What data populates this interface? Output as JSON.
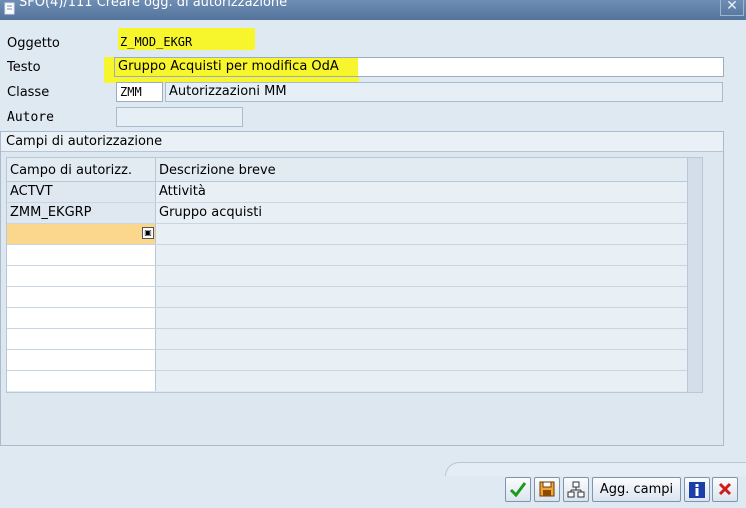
{
  "window": {
    "title": "SFO(4)/111 Creare ogg. di autorizzazione",
    "close_glyph": "✕"
  },
  "form": {
    "oggetto": {
      "label": "Oggetto",
      "value": "Z_MOD_EKGR"
    },
    "testo": {
      "label": "Testo",
      "value": "Gruppo Acquisti per modifica OdA"
    },
    "classe": {
      "label": "Classe",
      "code": "ZMM",
      "description": "Autorizzazioni MM"
    },
    "autore": {
      "label": "Autore",
      "value": ""
    }
  },
  "fields_group": {
    "title": "Campi di autorizzazione",
    "columns": [
      "Campo di autorizz.",
      "Descrizione breve"
    ],
    "rows": [
      {
        "field": "ACTVT",
        "description": "Attività"
      },
      {
        "field": "ZMM_EKGRP",
        "description": "Gruppo acquisti"
      },
      {
        "field": "",
        "description": ""
      },
      {
        "field": "",
        "description": ""
      },
      {
        "field": "",
        "description": ""
      },
      {
        "field": "",
        "description": ""
      },
      {
        "field": "",
        "description": ""
      },
      {
        "field": "",
        "description": ""
      },
      {
        "field": "",
        "description": ""
      },
      {
        "field": "",
        "description": ""
      }
    ]
  },
  "buttons": {
    "add_fields_label": "Agg. campi"
  },
  "icons": {
    "confirm": "check-icon",
    "save": "save-icon",
    "hierarchy": "hierarchy-icon",
    "info": "info-icon",
    "cancel": "cancel-icon"
  },
  "colors": {
    "highlight": "#f7f62c",
    "title_bar": "#5b7ba4",
    "confirm_green": "#1c9a1c",
    "cancel_red": "#d11a1a",
    "info_blue": "#1b3ea8"
  }
}
